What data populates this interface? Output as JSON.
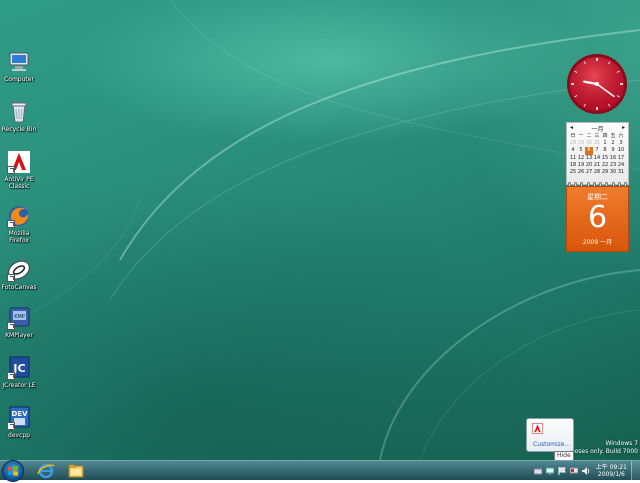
{
  "desktop_icons": [
    {
      "label": "Computer",
      "icon": "computer-icon"
    },
    {
      "label": "Recycle Bin",
      "icon": "recycle-bin-icon"
    },
    {
      "label": "AntiVir PE Classic",
      "icon": "antivir-icon"
    },
    {
      "label": "Mozilla Firefox",
      "icon": "firefox-icon"
    },
    {
      "label": "FotoCanvas",
      "icon": "fotocanvas-icon"
    },
    {
      "label": "KMPlayer",
      "icon": "kmplayer-icon"
    },
    {
      "label": "JCreator LE",
      "icon": "jcreator-icon"
    },
    {
      "label": "devcpp",
      "icon": "devcpp-icon"
    }
  ],
  "calendar": {
    "month_title": "一月",
    "weekday_headers": [
      "日",
      "一",
      "二",
      "三",
      "四",
      "五",
      "六"
    ],
    "days": [
      [
        "28",
        "29",
        "30",
        "31",
        "1",
        "2",
        "3"
      ],
      [
        "4",
        "5",
        "6",
        "7",
        "8",
        "9",
        "10"
      ],
      [
        "11",
        "12",
        "13",
        "14",
        "15",
        "16",
        "17"
      ],
      [
        "18",
        "19",
        "20",
        "21",
        "22",
        "23",
        "24"
      ],
      [
        "25",
        "26",
        "27",
        "28",
        "29",
        "30",
        "31"
      ]
    ],
    "weekday_label": "星期二",
    "day": "6",
    "year_month": "2009 一月"
  },
  "clock_gadget": {
    "hour": 9,
    "minute": 21,
    "color": "#c8102e"
  },
  "watermark": {
    "line1": "Windows 7",
    "line2": "rposes only. Build 7000"
  },
  "tray_popup": {
    "customize_label": "Customize...",
    "tooltip": "Hide"
  },
  "taskbar": {
    "pinned": [
      "internet-explorer-icon",
      "windows-explorer-icon"
    ],
    "time": "上午 09:21",
    "date": "2009/1/6"
  },
  "colors": {
    "accent_orange": "#e06d1b",
    "clock_red": "#c8102e",
    "desktop_teal": "#2a8f7c"
  }
}
